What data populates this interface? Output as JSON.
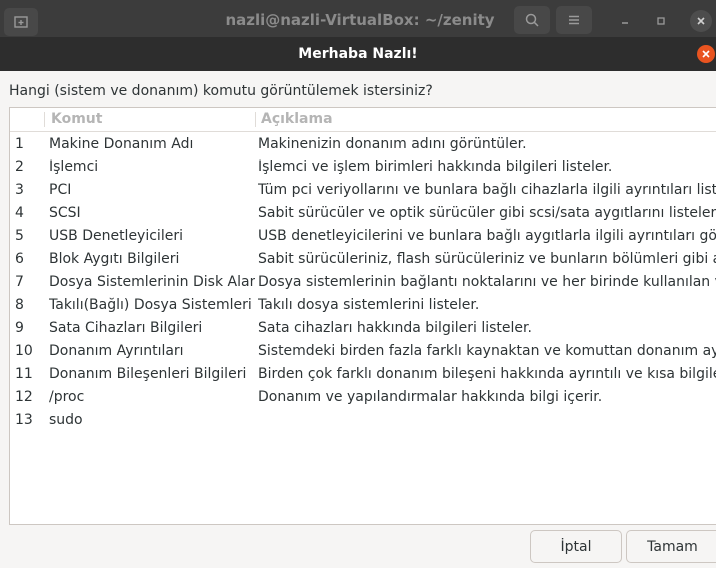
{
  "terminal": {
    "title": "nazli@nazli-VirtualBox: ~/zenity"
  },
  "dialog": {
    "title": "Merhaba Nazlı!",
    "prompt": "Hangi (sistem ve donanım) komutu görüntülemek istersiniz?",
    "columns": {
      "num": "",
      "command": "Komut",
      "description": "Açıklama"
    },
    "rows": [
      {
        "num": "1",
        "command": "Makine Donanım Adı",
        "description": "Makinenizin donanım adını görüntüler."
      },
      {
        "num": "2",
        "command": "İşlemci",
        "description": "İşlemci ve işlem birimleri  hakkında bilgileri listeler."
      },
      {
        "num": "3",
        "command": "PCI",
        "description": "Tüm pci veriyollarını ve bunlara bağlı cihazlarla ilgili ayrıntıları listeler."
      },
      {
        "num": "4",
        "command": "SCSI",
        "description": "Sabit sürücüler ve optik sürücüler gibi scsi/sata aygıtlarını listeler."
      },
      {
        "num": "5",
        "command": "USB Denetleyicileri",
        "description": "USB denetleyicilerini ve bunlara bağlı aygıtlarla ilgili ayrıntıları gösterir."
      },
      {
        "num": "6",
        "command": "Blok Aygıtı Bilgileri",
        "description": "Sabit sürücüleriniz, flash sürücüleriniz ve bunların bölümleri gibi ayrıntılar."
      },
      {
        "num": "7",
        "command": "Dosya Sistemlerinin Disk Alanı",
        "description": "Dosya sistemlerinin bağlantı noktalarını ve her birinde kullanılan ve kalan alan."
      },
      {
        "num": "8",
        "command": "Takılı(Bağlı) Dosya Sistemleri",
        "description": "Takılı dosya sistemlerini listeler."
      },
      {
        "num": "9",
        "command": "Sata Cihazları Bilgileri",
        "description": "Sata cihazları hakkında bilgileri listeler."
      },
      {
        "num": "10",
        "command": "Donanım Ayrıntıları",
        "description": "Sistemdeki birden fazla farklı kaynaktan ve komuttan donanım ayrıntıları."
      },
      {
        "num": "11",
        "command": "Donanım Bileşenleri Bilgileri",
        "description": "Birden çok farklı donanım bileşeni hakkında ayrıntılı ve kısa bilgilerle."
      },
      {
        "num": "12",
        "command": "/proc",
        "description": "Donanım ve yapılandırmalar hakkında bilgi içerir."
      },
      {
        "num": "13",
        "command": "sudo",
        "description": ""
      }
    ],
    "buttons": {
      "cancel": "İptal",
      "ok": "Tamam"
    }
  },
  "icons": {
    "new_tab": "new-tab-icon",
    "search": "search-icon",
    "menu": "hamburger-menu-icon",
    "minimize": "minimize-icon",
    "maximize": "maximize-icon",
    "close": "close-icon"
  },
  "colors": {
    "dialog_header": "#2d2d2d",
    "close_accent": "#e95420",
    "header_text": "#b5b5b5"
  }
}
